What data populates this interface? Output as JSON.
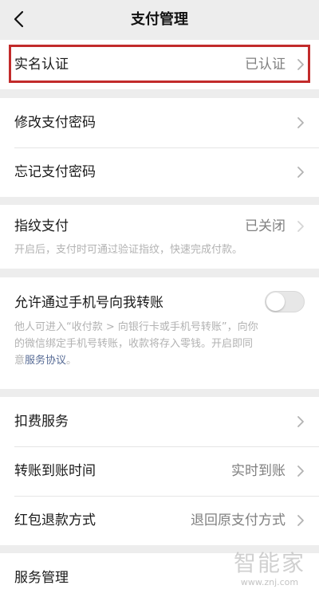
{
  "nav": {
    "title": "支付管理"
  },
  "rows": {
    "realname": {
      "label": "实名认证",
      "value": "已认证"
    },
    "modify_pwd": {
      "label": "修改支付密码"
    },
    "forgot_pwd": {
      "label": "忘记支付密码"
    },
    "fingerprint": {
      "label": "指纹支付",
      "value": "已关闭",
      "desc": "开启后，支付时可通过验证指纹，快速完成付款。"
    },
    "phone_transfer": {
      "label": "允许通过手机号向我转账",
      "toggle_on": false,
      "desc_line1": "他人可进入“收付款 > 向银行卡或手机号转账”，向你",
      "desc_line2": "的微信绑定手机号转账，收款将存入零钱。开启即同",
      "desc_line3_prefix": "意",
      "desc_link": "服务协议",
      "desc_line3_suffix": "。"
    },
    "deduction": {
      "label": "扣费服务"
    },
    "transfer_time": {
      "label": "转账到账时间",
      "value": "实时到账"
    },
    "refund": {
      "label": "红包退款方式",
      "value": "退回原支付方式"
    },
    "service_mgmt": {
      "label": "服务管理"
    }
  },
  "watermark": {
    "logo": "智能家",
    "url": "www.znj.com"
  },
  "colors": {
    "background": "#ededed",
    "card": "#ffffff",
    "highlight_border": "#c22b2b",
    "link": "#576b95",
    "secondary_text": "#808080",
    "hint_text": "#b2b2b2"
  },
  "icons": {
    "back": "back-arrow-icon",
    "chevron": "chevron-right-icon"
  }
}
